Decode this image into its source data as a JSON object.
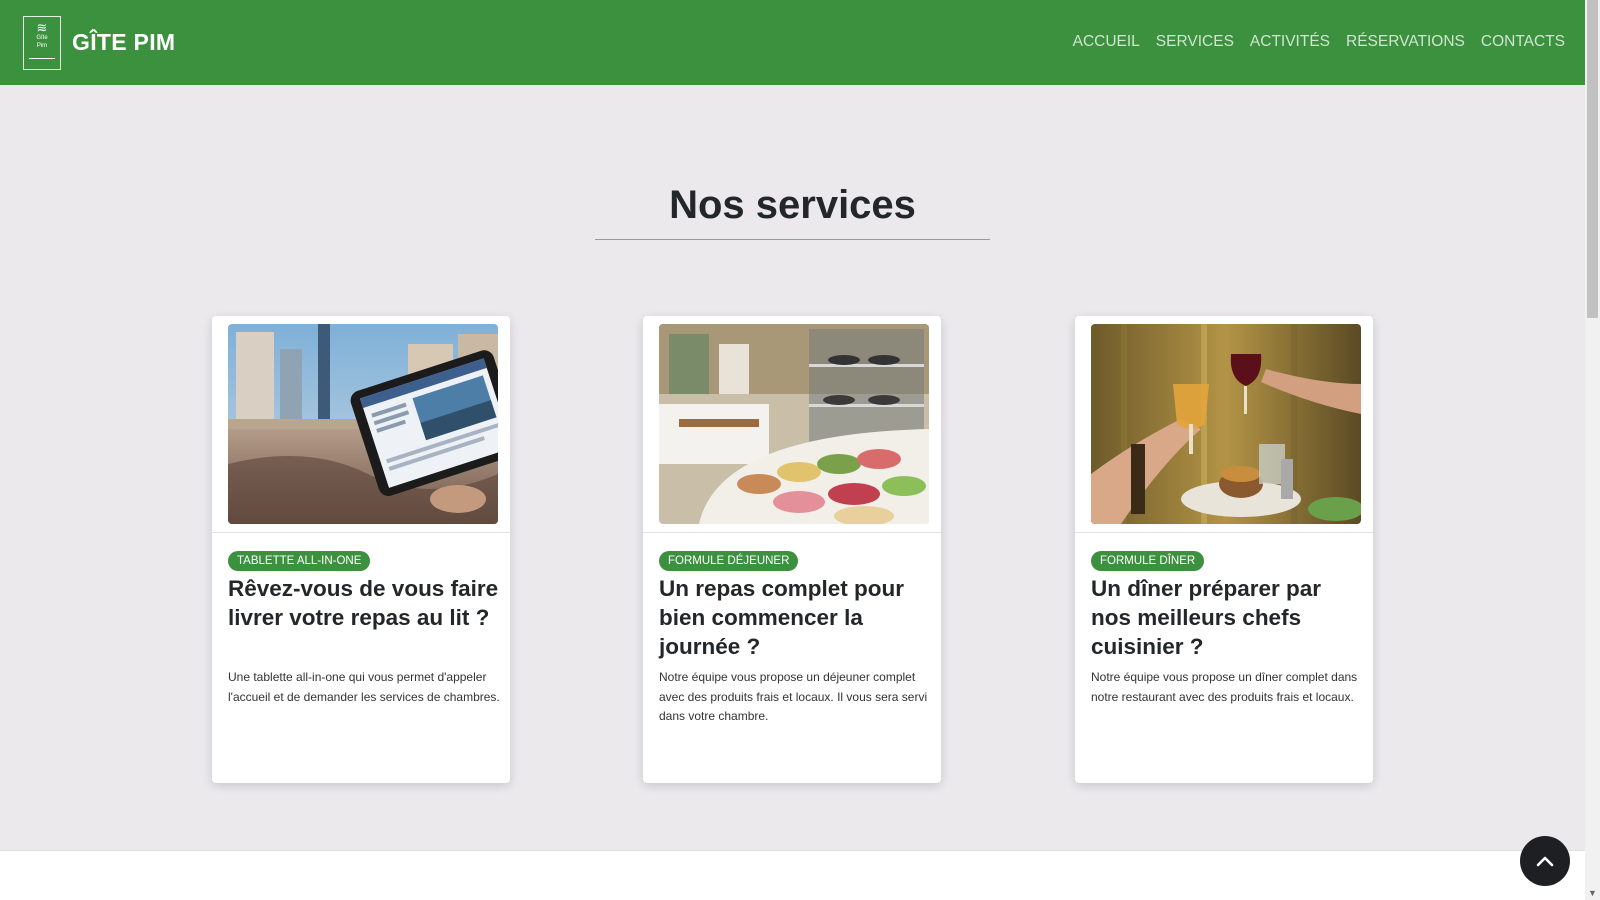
{
  "header": {
    "brand_name": "GÎTE PIM",
    "logo_text_1": "Gîte",
    "logo_text_2": "Pim",
    "nav": [
      "ACCUEIL",
      "SERVICES",
      "ACTIVITÉS",
      "RÉSERVATIONS",
      "CONTACTS"
    ]
  },
  "section": {
    "title": "Nos services"
  },
  "cards": [
    {
      "badge": "TABLETTE ALL-IN-ONE",
      "title": "Rêvez-vous de vous faire livrer votre repas au lit ?",
      "text": "Une tablette all-in-one qui vous permet d'appeler l'accueil et de demander les services de chambres.",
      "image": "tablet-in-bed-photo"
    },
    {
      "badge": "FORMULE DÉJEUNER",
      "title": "Un repas complet pour bien commencer la journée ?",
      "text": "Notre équipe vous propose un déjeuner complet avec des produits frais et locaux. Il vous sera servi dans votre chambre.",
      "image": "buffet-photo"
    },
    {
      "badge": "FORMULE DÎNER",
      "title": "Un dîner préparer par nos meilleurs chefs cuisinier ?",
      "text": "Notre équipe vous propose un dîner complet dans notre restaurant avec des produits frais et locaux.",
      "image": "dinner-toast-photo"
    }
  ],
  "colors": {
    "primary": "#3c913e",
    "background": "#ebe9ec",
    "text": "#23272a"
  }
}
